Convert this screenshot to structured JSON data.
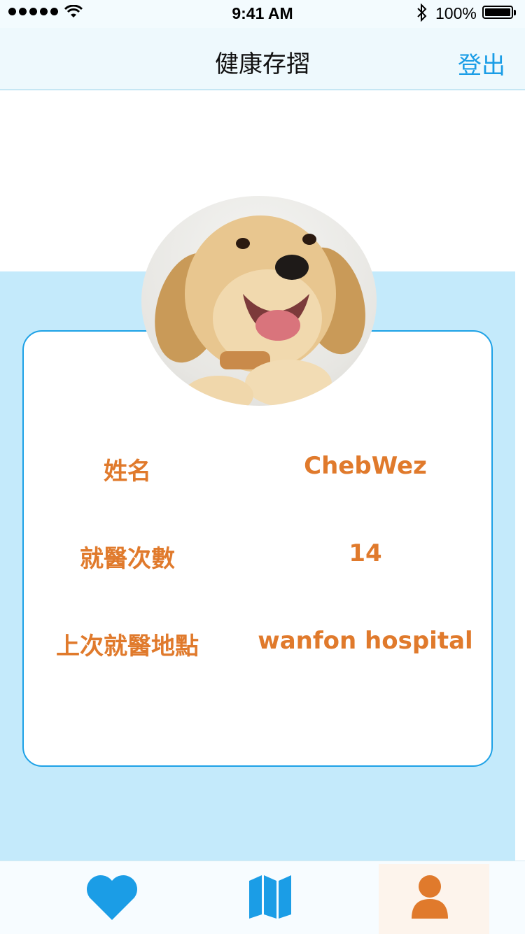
{
  "status_bar": {
    "time": "9:41 AM",
    "battery": "100%"
  },
  "nav": {
    "title": "健康存摺",
    "logout_label": "登出"
  },
  "profile": {
    "avatar_icon": "puppy-photo",
    "rows": [
      {
        "label": "姓名",
        "value": "ChebWez"
      },
      {
        "label": "就醫次數",
        "value": "14"
      },
      {
        "label": "上次就醫地點",
        "value": "wanfon hospital"
      }
    ]
  },
  "tab_bar": {
    "items": [
      {
        "icon": "heart-icon",
        "color": "#1b9de6"
      },
      {
        "icon": "map-icon",
        "color": "#1b9de6"
      },
      {
        "icon": "user-icon",
        "color": "#e07a2c",
        "active": true
      }
    ]
  },
  "colors": {
    "accent_blue": "#1da1e6",
    "panel_blue": "#c4eafb",
    "label_orange": "#e07a2c"
  }
}
